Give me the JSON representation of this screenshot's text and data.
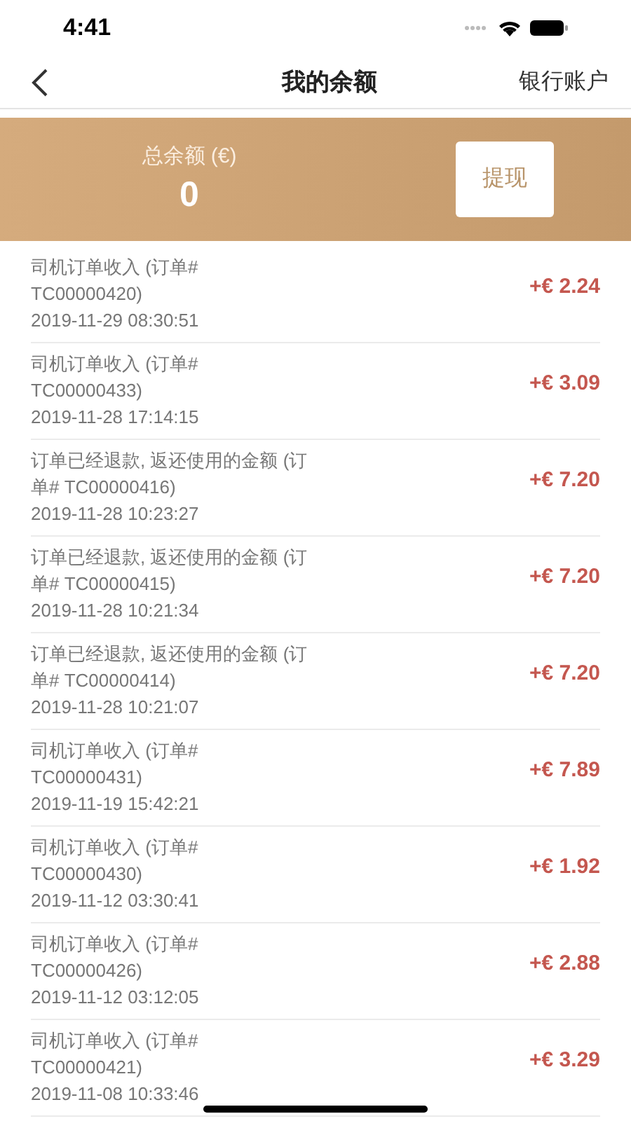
{
  "status_bar": {
    "time": "4:41"
  },
  "nav": {
    "title": "我的余额",
    "action": "银行账户"
  },
  "balance": {
    "label": "总余额 (€)",
    "amount": "0",
    "button": "提现"
  },
  "transactions": [
    {
      "lines": [
        "司机订单收入 (订单#",
        "TC00000420)"
      ],
      "time": "2019-11-29 08:30:51",
      "amount": "+€ 2.24"
    },
    {
      "lines": [
        "司机订单收入 (订单#",
        "TC00000433)"
      ],
      "time": "2019-11-28 17:14:15",
      "amount": "+€ 3.09"
    },
    {
      "lines": [
        "订单已经退款, 返还使用的金额 (订",
        "单# TC00000416)"
      ],
      "time": "2019-11-28 10:23:27",
      "amount": "+€ 7.20"
    },
    {
      "lines": [
        "订单已经退款, 返还使用的金额 (订",
        "单# TC00000415)"
      ],
      "time": "2019-11-28 10:21:34",
      "amount": "+€ 7.20"
    },
    {
      "lines": [
        "订单已经退款, 返还使用的金额 (订",
        "单# TC00000414)"
      ],
      "time": "2019-11-28 10:21:07",
      "amount": "+€ 7.20"
    },
    {
      "lines": [
        "司机订单收入 (订单#",
        "TC00000431)"
      ],
      "time": "2019-11-19 15:42:21",
      "amount": "+€ 7.89"
    },
    {
      "lines": [
        "司机订单收入 (订单#",
        "TC00000430)"
      ],
      "time": "2019-11-12 03:30:41",
      "amount": "+€ 1.92"
    },
    {
      "lines": [
        "司机订单收入 (订单#",
        "TC00000426)"
      ],
      "time": "2019-11-12 03:12:05",
      "amount": "+€ 2.88"
    },
    {
      "lines": [
        "司机订单收入 (订单#",
        "TC00000421)"
      ],
      "time": "2019-11-08 10:33:46",
      "amount": "+€ 3.29"
    }
  ]
}
